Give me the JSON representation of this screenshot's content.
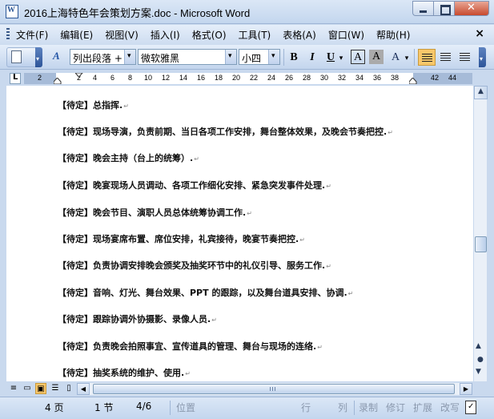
{
  "window": {
    "title": "2016上海特色年会策划方案.doc - Microsoft Word"
  },
  "menu": {
    "items": [
      "文件(F)",
      "编辑(E)",
      "视图(V)",
      "插入(I)",
      "格式(O)",
      "工具(T)",
      "表格(A)",
      "窗口(W)",
      "帮助(H)"
    ],
    "close_label": "×"
  },
  "toolbar": {
    "style_value": "列出段落 +",
    "font_value": "微软雅黑",
    "size_value": "小四",
    "bold_label": "B",
    "italic_label": "I",
    "underline_label": "U",
    "charborder_label": "A",
    "charshade_label": "A",
    "highlight_label": "A"
  },
  "ruler": {
    "numbers": [
      "2",
      "2",
      "4",
      "6",
      "8",
      "10",
      "12",
      "14",
      "16",
      "18",
      "20",
      "22",
      "24",
      "26",
      "28",
      "30",
      "32",
      "34",
      "36",
      "38",
      "42",
      "44"
    ]
  },
  "document": {
    "paragraphs": [
      "【待定】总指挥.",
      "【待定】现场导演，负责前期、当日各项工作安排，舞台整体效果，及晚会节奏把控.",
      "【待定】晚会主持（台上的统筹）.",
      "【待定】晚宴现场人员调动、各项工作细化安排、紧急突发事件处理.",
      "【待定】晚会节目、演职人员总体统筹协调工作.",
      "【待定】现场宴席布置、席位安排，礼宾接待，晚宴节奏把控.",
      "【待定】负责协调安排晚会颁奖及抽奖环节中的礼仪引导、服务工作.",
      "【待定】音响、灯光、舞台效果、PPT 的跟踪，以及舞台道具安排、协调.",
      "【待定】跟踪协调外协摄影、录像人员.",
      "【待定】负责晚会拍照事宜、宣传道具的管理、舞台与现场的连络.",
      "【待定】抽奖系统的维护、使用."
    ],
    "para_mark": "↵"
  },
  "statusbar": {
    "page": "4 页",
    "section": "1 节",
    "page_of": "4/6",
    "position": "位置",
    "line": "行",
    "col": "列",
    "rec": "录制",
    "trk": "修订",
    "ext": "扩展",
    "ovr": "改写"
  }
}
